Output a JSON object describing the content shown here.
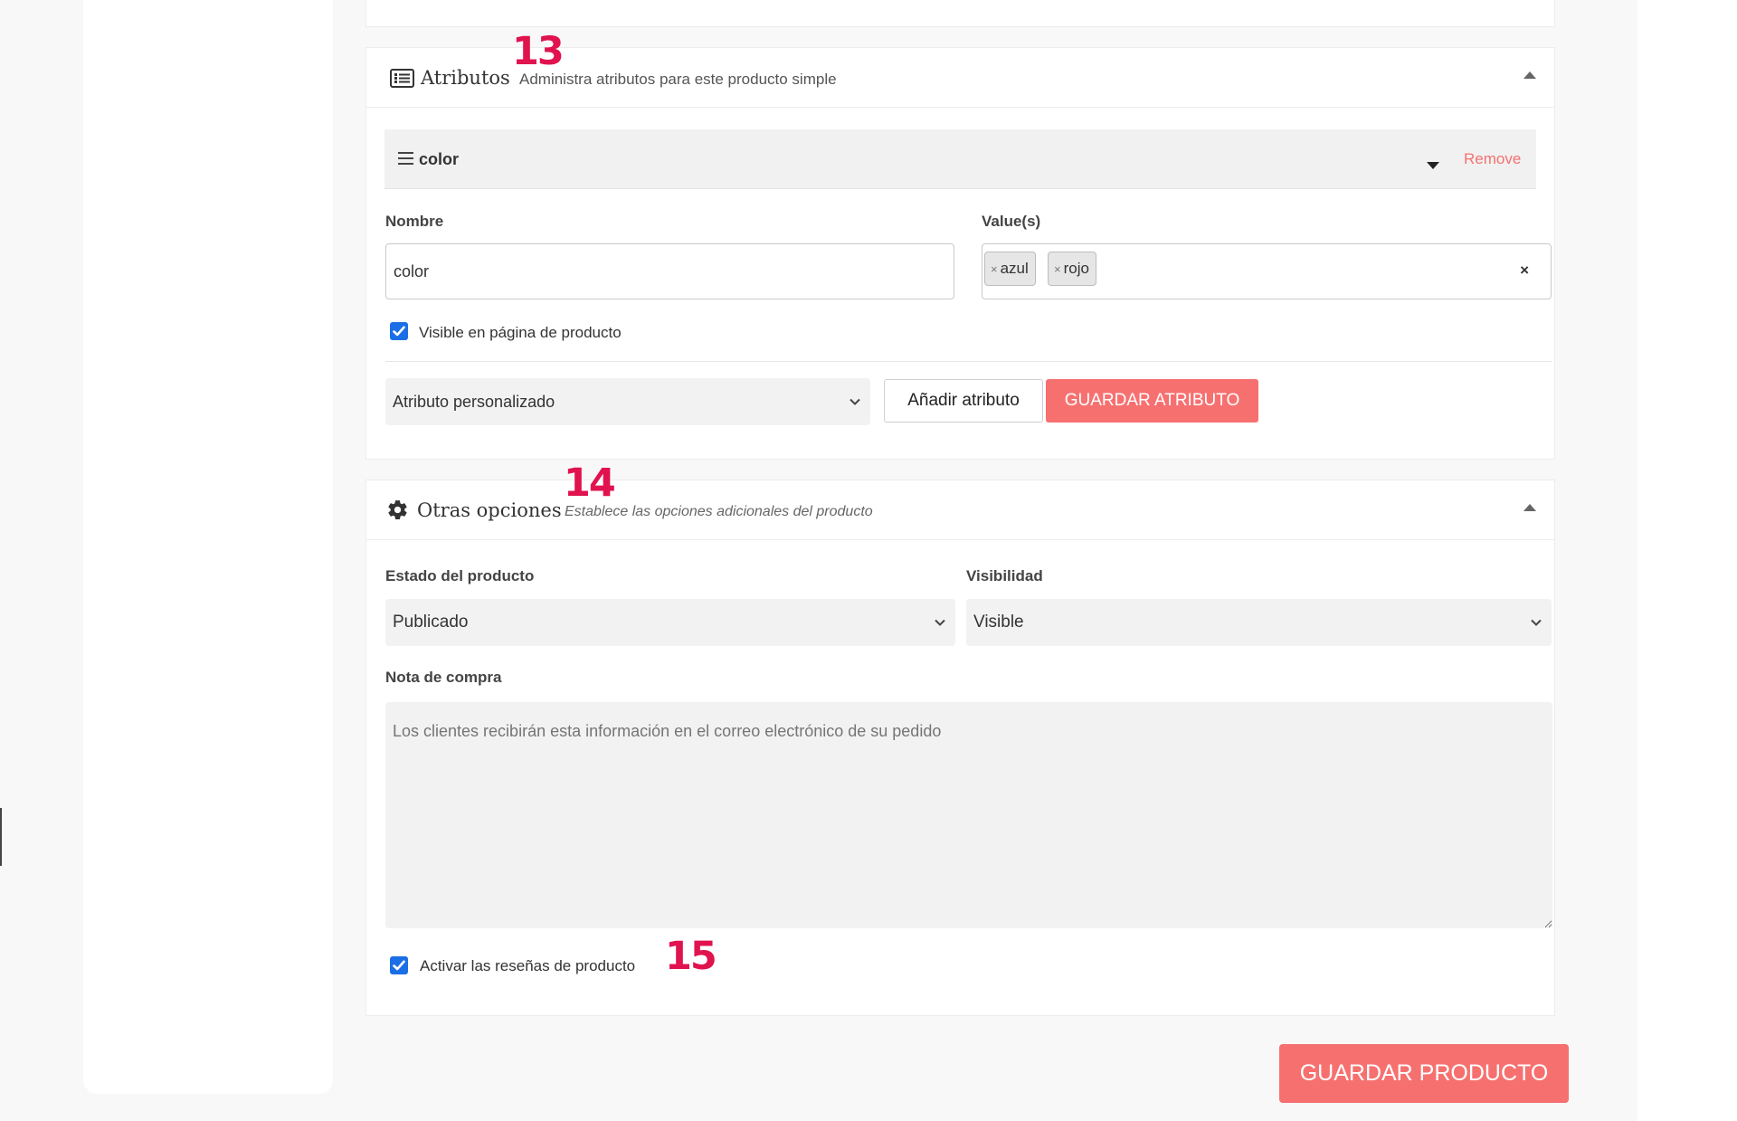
{
  "annotations": {
    "n13": "13",
    "n14": "14",
    "n15": "15"
  },
  "icons": {
    "attributes_header": "list-alt-icon",
    "options_header": "gear-icon",
    "drag_handle": "hamburger-icon",
    "collapse": "caret-up-icon",
    "expand_row": "caret-down-icon",
    "tag_remove": "times-icon",
    "select": "chevron-down-icon",
    "checkbox": "checkmark-icon"
  },
  "colors": {
    "accent": "#f77070",
    "annotation": "#e0134f",
    "checkbox": "#1a6ee6",
    "remove_link": "#f77070"
  },
  "attributes": {
    "title": "Atributos",
    "subtitle": "Administra atributos para este producto simple",
    "row": {
      "name": "color",
      "remove_label": "Remove",
      "name_label": "Nombre",
      "name_value": "color",
      "values_label": "Value(s)",
      "values": [
        "azul",
        "rojo"
      ],
      "clear_label": "×",
      "visible_label": "Visible en página de producto",
      "visible_checked": true
    },
    "type_select": {
      "value": "Atributo personalizado"
    },
    "add_button": "Añadir atributo",
    "save_button": "GUARDAR ATRIBUTO"
  },
  "options": {
    "title": "Otras opciones",
    "subtitle": "Establece las opciones adicionales del producto",
    "status_label": "Estado del producto",
    "status_value": "Publicado",
    "visibility_label": "Visibilidad",
    "visibility_value": "Visible",
    "note_label": "Nota de compra",
    "note_placeholder": "Los clientes recibirán esta información en el correo electrónico de su pedido",
    "note_value": "",
    "reviews_label": "Activar las reseñas de producto",
    "reviews_checked": true
  },
  "footer": {
    "save_product_button": "GUARDAR PRODUCTO"
  }
}
